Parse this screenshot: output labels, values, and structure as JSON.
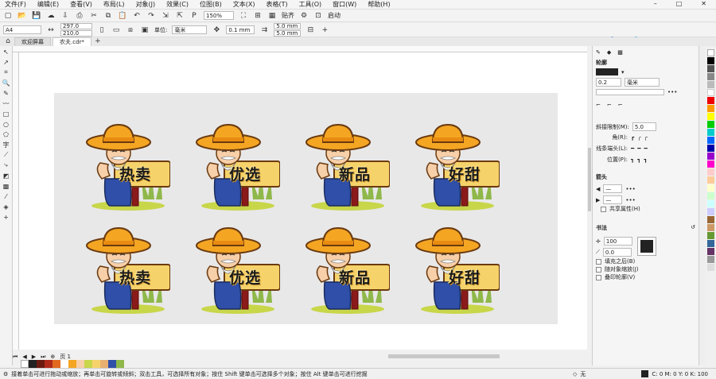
{
  "menu": [
    "文件(F)",
    "编辑(E)",
    "查看(V)",
    "布局(L)",
    "对象(J)",
    "效果(C)",
    "位图(B)",
    "文本(X)",
    "表格(T)",
    "工具(O)",
    "窗口(W)",
    "帮助(H)"
  ],
  "toolbar1": {
    "zoom": "150%",
    "snap_label": "贴齐",
    "launch_label": "启动"
  },
  "toolbar2": {
    "page_size": "A4",
    "width": "297.0 mm",
    "height": "210.0 mm",
    "units_label": "单位:",
    "units_value": "毫米",
    "nudge": "0.1 mm",
    "dup_x": "5.0 mm",
    "dup_y": "5.0 mm"
  },
  "tabs": [
    {
      "label": "欢迎屏幕"
    },
    {
      "label": "农夫.cdr*"
    }
  ],
  "stickers": [
    {
      "text": "热卖"
    },
    {
      "text": "优选"
    },
    {
      "text": "新品"
    },
    {
      "text": "好甜"
    },
    {
      "text": "热卖"
    },
    {
      "text": "优选"
    },
    {
      "text": "新品"
    },
    {
      "text": "好甜"
    }
  ],
  "pagebar": {
    "page_label": "页 1"
  },
  "statusbar": {
    "hint": "接着单击可进行拖动或缩放；再单击可旋转或倾斜；双击工具，可选择所有对象；按住 Shift 键单击可选择多个对象；按住 Alt 键单击可进行挖掘",
    "fill_none": "无",
    "cmyk": "C: 0 M: 0 Y: 0 K: 100"
  },
  "docker": {
    "section": "轮廓",
    "width": "0.2 mm",
    "unit": "毫米",
    "miter_label": "斜接限制(M):",
    "miter_value": "5.0",
    "corner_label": "角(R):",
    "cap_label": "线条端头(L):",
    "pos_label": "位置(P):",
    "arrow_section": "箭头",
    "share_attr": "共享属性(H)",
    "calligraphy": "书法",
    "stretch": "100",
    "angle": "0.0",
    "fill_behind": "填充之后(B)",
    "scale_with": "随对象缩放(J)",
    "overprint": "叠印轮廓(V)"
  },
  "ime": {
    "label": "英"
  },
  "colors": {
    "accent": "#1e6fd9",
    "hat": "#f4a623",
    "shirt": "#2f4fa8",
    "sign": "#8b1a1a"
  }
}
